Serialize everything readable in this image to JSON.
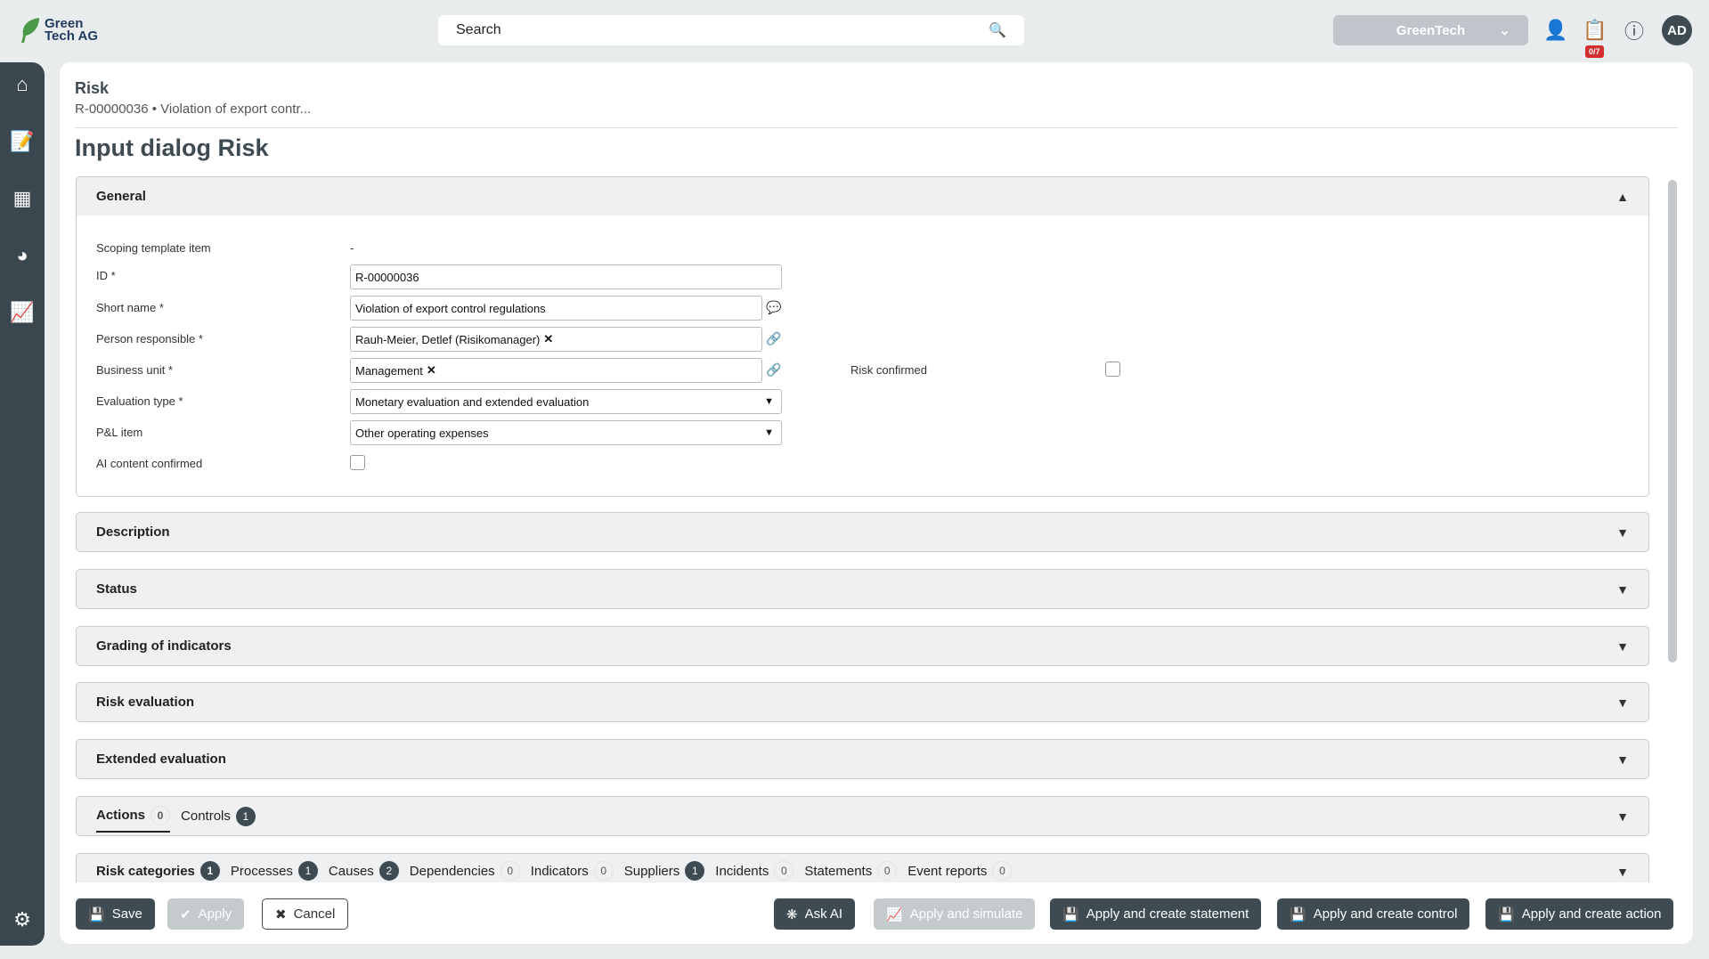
{
  "header": {
    "logo_line1": "Green",
    "logo_line2": "Tech AG",
    "search_placeholder": "Search",
    "tenant": "GreenTech",
    "tasks_badge": "0/7",
    "avatar": "AD"
  },
  "breadcrumb": {
    "title": "Risk",
    "subtitle": "R-00000036 • Violation of export contr..."
  },
  "page_title": "Input dialog Risk",
  "general": {
    "title": "General",
    "fields": {
      "scoping_label": "Scoping template item",
      "scoping_value": "-",
      "id_label": "ID *",
      "id_value": "R-00000036",
      "short_label": "Short name *",
      "short_value": "Violation of export control regulations",
      "person_label": "Person responsible *",
      "person_value": "Rauh-Meier, Detlef (Risikomanager)",
      "bu_label": "Business unit *",
      "bu_value": "Management",
      "eval_label": "Evaluation type *",
      "eval_value": "Monetary evaluation and extended evaluation",
      "pl_label": "P&L item",
      "pl_value": "Other operating expenses",
      "ai_label": "AI content confirmed",
      "risk_confirmed_label": "Risk confirmed"
    }
  },
  "sections": [
    "Description",
    "Status",
    "Grading of indicators",
    "Risk evaluation",
    "Extended evaluation"
  ],
  "tabs1": [
    {
      "label": "Actions",
      "count": "0"
    },
    {
      "label": "Controls",
      "count": "1"
    }
  ],
  "tabs2": [
    {
      "label": "Risk categories",
      "count": "1"
    },
    {
      "label": "Processes",
      "count": "1"
    },
    {
      "label": "Causes",
      "count": "2"
    },
    {
      "label": "Dependencies",
      "count": "0"
    },
    {
      "label": "Indicators",
      "count": "0"
    },
    {
      "label": "Suppliers",
      "count": "1"
    },
    {
      "label": "Incidents",
      "count": "0"
    },
    {
      "label": "Statements",
      "count": "0"
    },
    {
      "label": "Event reports",
      "count": "0"
    }
  ],
  "footer": {
    "save": "Save",
    "apply": "Apply",
    "cancel": "Cancel",
    "ask_ai": "Ask AI",
    "apply_simulate": "Apply and simulate",
    "apply_statement": "Apply and create statement",
    "apply_control": "Apply and create control",
    "apply_action": "Apply and create action"
  }
}
